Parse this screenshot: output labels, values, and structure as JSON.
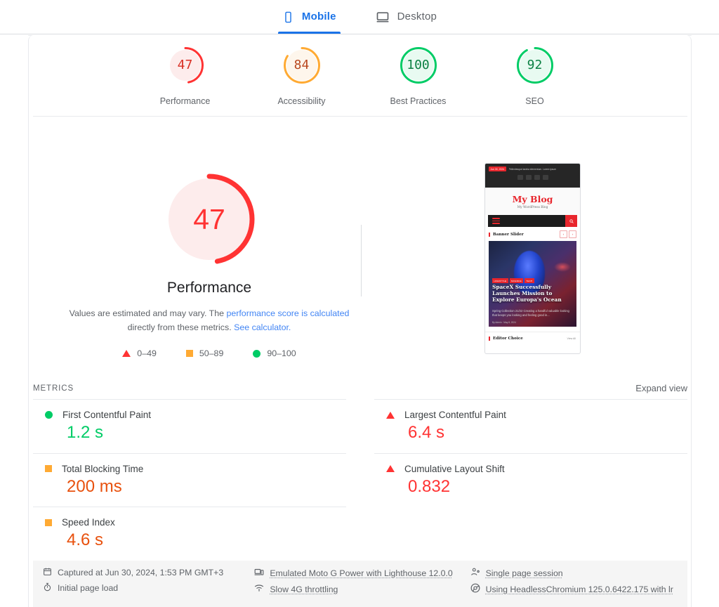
{
  "tabs": [
    {
      "label": "Mobile",
      "icon": "mobile-phone-icon",
      "active": true
    },
    {
      "label": "Desktop",
      "icon": "desktop-monitor-icon",
      "active": false
    }
  ],
  "category_scores": [
    {
      "label": "Performance",
      "value": "47",
      "pct": 47,
      "color": "#f33",
      "bg": "#fdecec"
    },
    {
      "label": "Accessibility",
      "value": "84",
      "pct": 84,
      "color": "#fa3",
      "bg": "#fef6ec"
    },
    {
      "label": "Best Practices",
      "value": "100",
      "pct": 100,
      "color": "#0c6",
      "bg": "#e8faf1"
    },
    {
      "label": "SEO",
      "value": "92",
      "pct": 92,
      "color": "#0c6",
      "bg": "#e8faf1"
    }
  ],
  "hero": {
    "score": "47",
    "title": "Performance",
    "desc_part1": "Values are estimated and may vary. The ",
    "desc_link1": "performance score is calculated",
    "desc_part2": " directly from these metrics. ",
    "desc_link2": "See calculator.",
    "legend": [
      {
        "icon": "triangle-red-icon",
        "range": "0–49"
      },
      {
        "icon": "square-orange-icon",
        "range": "50–89"
      },
      {
        "icon": "circle-green-icon",
        "range": "90–100"
      }
    ]
  },
  "thumbnail": {
    "alt": "page-screenshot-thumbnail",
    "date_pill": "Jun 30, 2024",
    "ticker": "Pellentesque lacinia elementum. Lorem ipsum",
    "brand": "My Blog",
    "tagline": "My WordPress Blog",
    "search_icon": "search-icon",
    "section_title": "Banner Slider",
    "prev_label": "‹",
    "next_label": "›",
    "categories": [
      "LIFESTYLE",
      "SCIENCE",
      "TECH"
    ],
    "headline": "SpaceX Successfully Launches Mission to Explore Europa's Ocean",
    "subtext": "Spring Collection 21/22 Creating a handful valuable looking that keeps you looking and feeling good in...",
    "meta": "By Admin · May 8, 2024",
    "footer_title": "Editor Choice",
    "footer_link": "View All"
  },
  "metrics_section": {
    "title": "METRICS",
    "expand_label": "Expand view",
    "left": [
      {
        "icon": "circle-green-icon",
        "name": "First Contentful Paint",
        "value": "1.2 s",
        "color": "#0c6"
      },
      {
        "icon": "square-orange-icon",
        "name": "Total Blocking Time",
        "value": "200 ms",
        "color": "#e8510e"
      },
      {
        "icon": "square-orange-icon",
        "name": "Speed Index",
        "value": "4.6 s",
        "color": "#e8510e"
      }
    ],
    "right": [
      {
        "icon": "triangle-red-icon",
        "name": "Largest Contentful Paint",
        "value": "6.4 s",
        "color": "#f33"
      },
      {
        "icon": "triangle-red-icon",
        "name": "Cumulative Layout Shift",
        "value": "0.832",
        "color": "#f33"
      }
    ]
  },
  "environment": {
    "col1": [
      {
        "icon": "calendar-icon",
        "text": "Captured at Jun 30, 2024, 1:53 PM GMT+3",
        "dotted": false
      },
      {
        "icon": "stopwatch-icon",
        "text": "Initial page load",
        "dotted": false
      }
    ],
    "col2": [
      {
        "icon": "devices-icon",
        "text": "Emulated Moto G Power with Lighthouse 12.0.0",
        "dotted": true
      },
      {
        "icon": "network-icon",
        "text": "Slow 4G throttling",
        "dotted": true
      }
    ],
    "col3": [
      {
        "icon": "single-user-icon",
        "text": "Single page session",
        "dotted": true
      },
      {
        "icon": "chrome-icon",
        "text": "Using HeadlessChromium 125.0.6422.175 with lr",
        "dotted": true
      }
    ]
  }
}
